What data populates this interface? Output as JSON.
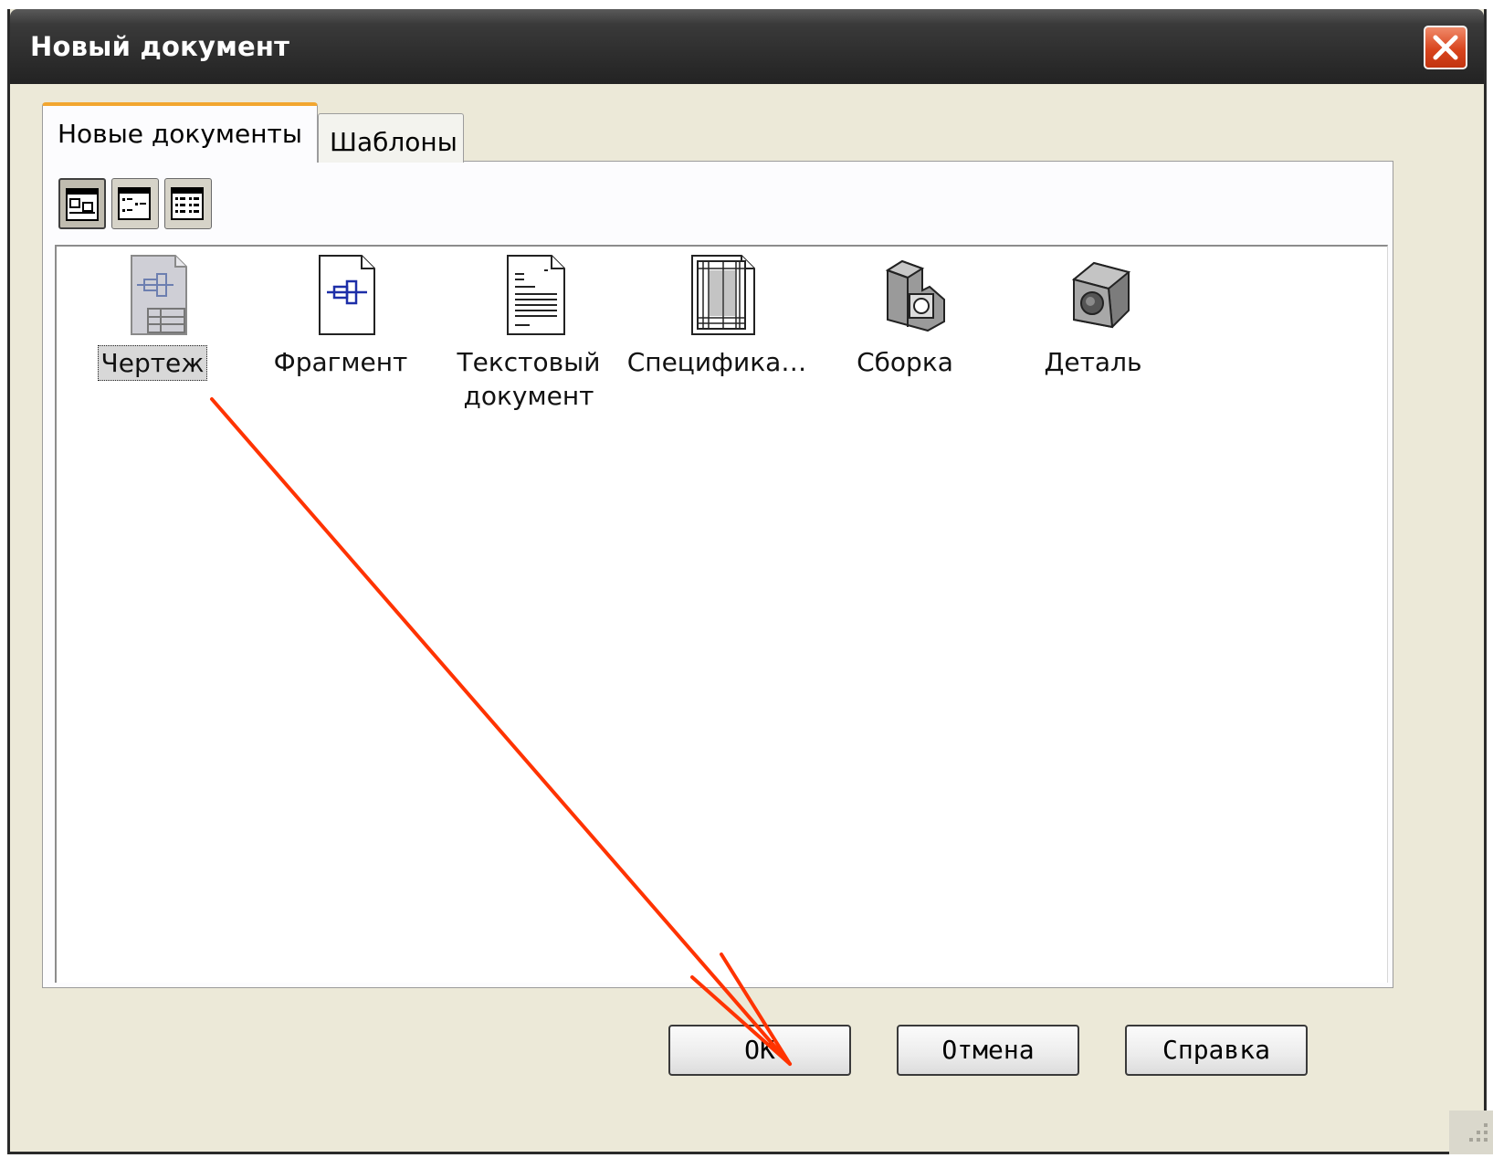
{
  "window": {
    "title": "Новый документ"
  },
  "tabs": [
    {
      "label": "Новые документы",
      "active": true
    },
    {
      "label": "Шаблоны",
      "active": false
    }
  ],
  "view_buttons": [
    {
      "icon": "large-icons-view-icon",
      "active": true
    },
    {
      "icon": "list-view-icon",
      "active": false
    },
    {
      "icon": "details-view-icon",
      "active": false
    }
  ],
  "documents": [
    {
      "label": "Чертеж",
      "icon": "drawing-icon",
      "selected": true
    },
    {
      "label": "Фрагмент",
      "icon": "fragment-icon",
      "selected": false
    },
    {
      "label": "Текстовый документ",
      "icon": "text-document-icon",
      "selected": false
    },
    {
      "label": "Специфика…",
      "icon": "specification-icon",
      "selected": false
    },
    {
      "label": "Сборка",
      "icon": "assembly-icon",
      "selected": false
    },
    {
      "label": "Деталь",
      "icon": "part-icon",
      "selected": false
    }
  ],
  "buttons": {
    "ok": "OK",
    "cancel": "Отмена",
    "help": "Справка"
  },
  "colors": {
    "title_bar": "#2e2e2e",
    "close_button": "#d9451e",
    "tab_accent": "#f2a630",
    "annotation_arrow": "#ff3300"
  }
}
